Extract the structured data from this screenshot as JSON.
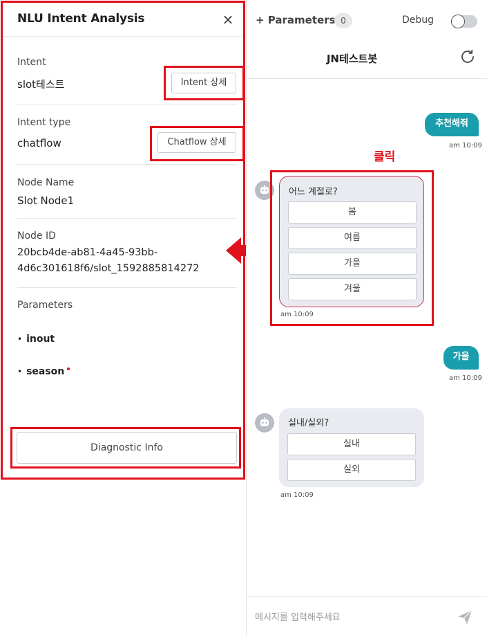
{
  "panel": {
    "title": "NLU Intent Analysis",
    "close_glyph": "×",
    "intent": {
      "label": "Intent",
      "value": "slot테스트",
      "button": "Intent 상세"
    },
    "intent_type": {
      "label": "Intent type",
      "value": "chatflow",
      "button": "Chatflow 상세"
    },
    "node_name": {
      "label": "Node Name",
      "value": "Slot Node1"
    },
    "node_id": {
      "label": "Node ID",
      "line1": "20bcb4de-ab81-4a45-93bb-",
      "line2": "4d6c301618f6/slot_1592885814272"
    },
    "parameters": {
      "label": "Parameters",
      "items": [
        {
          "bullet": "•",
          "name": "inout",
          "required": false
        },
        {
          "bullet": "•",
          "name": "season",
          "required": true
        }
      ]
    },
    "diagnostic_button": "Diagnostic Info"
  },
  "annotation": {
    "click_label": "클릭",
    "color": "#e0121b"
  },
  "chat": {
    "topbar": {
      "parameters_tab": "+ Parameters",
      "parameters_count": "0",
      "debug_label": "Debug",
      "debug_on": false
    },
    "title": "JN테스트봇",
    "messages": [
      {
        "type": "user",
        "text": "추천해줘",
        "time": "am 10:09"
      },
      {
        "type": "bot",
        "question": "어느 계절로?",
        "options": [
          "봄",
          "여름",
          "가을",
          "겨울"
        ],
        "time": "am 10:09"
      },
      {
        "type": "user",
        "text": "가을",
        "time": "am 10:09"
      },
      {
        "type": "bot",
        "question": "실내/실외?",
        "options": [
          "실내",
          "실외"
        ],
        "time": "am 10:09"
      }
    ],
    "input_placeholder": "메시지를 입력해주세요"
  },
  "colors": {
    "accent_teal": "#1a9dac",
    "highlight_red": "#e0121b",
    "bot_bubble": "#e9ebf0"
  }
}
